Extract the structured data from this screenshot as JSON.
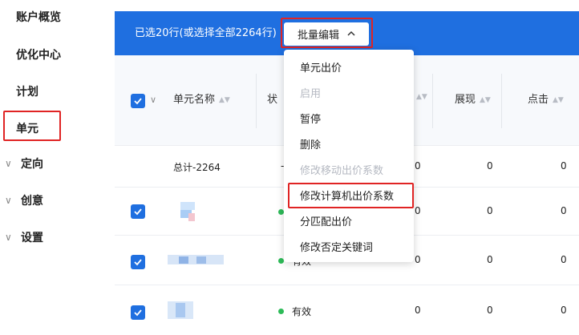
{
  "sidebar": {
    "items": [
      {
        "label": "账户概览",
        "expandable": false
      },
      {
        "label": "优化中心",
        "expandable": false
      },
      {
        "label": "计划",
        "expandable": false
      },
      {
        "label": "单元",
        "expandable": false,
        "selected": true
      },
      {
        "label": "定向",
        "expandable": true
      },
      {
        "label": "创意",
        "expandable": true
      },
      {
        "label": "设置",
        "expandable": true
      }
    ]
  },
  "toolbar": {
    "selection_text": "已选20行(或选择全部2264行)",
    "batch_edit_label": "批量编辑"
  },
  "table": {
    "headers": {
      "name": "单元名称",
      "status_partial": "状",
      "impressions": "展现",
      "clicks": "点击"
    },
    "total_row": {
      "name": "总计-2264",
      "status": "-",
      "col3": "0",
      "impressions": "0",
      "clicks": "0"
    },
    "rows": [
      {
        "status": "有效",
        "col3": "0",
        "impressions": "0",
        "clicks": "0"
      },
      {
        "status": "有效",
        "col3": "0",
        "impressions": "0",
        "clicks": "0"
      },
      {
        "status": "有效",
        "col3": "0",
        "impressions": "0",
        "clicks": "0"
      }
    ]
  },
  "dropdown": {
    "items": [
      {
        "label": "单元出价",
        "disabled": false
      },
      {
        "label": "启用",
        "disabled": true
      },
      {
        "label": "暂停",
        "disabled": false
      },
      {
        "label": "删除",
        "disabled": false
      },
      {
        "label": "修改移动出价系数",
        "disabled": true
      },
      {
        "label": "修改计算机出价系数",
        "disabled": false,
        "highlighted": true
      },
      {
        "label": "分匹配出价",
        "disabled": false
      },
      {
        "label": "修改否定关键词",
        "disabled": false
      }
    ]
  },
  "colors": {
    "accent": "#1f6fe0",
    "highlight": "#e02424",
    "status_active": "#2dbb58"
  }
}
